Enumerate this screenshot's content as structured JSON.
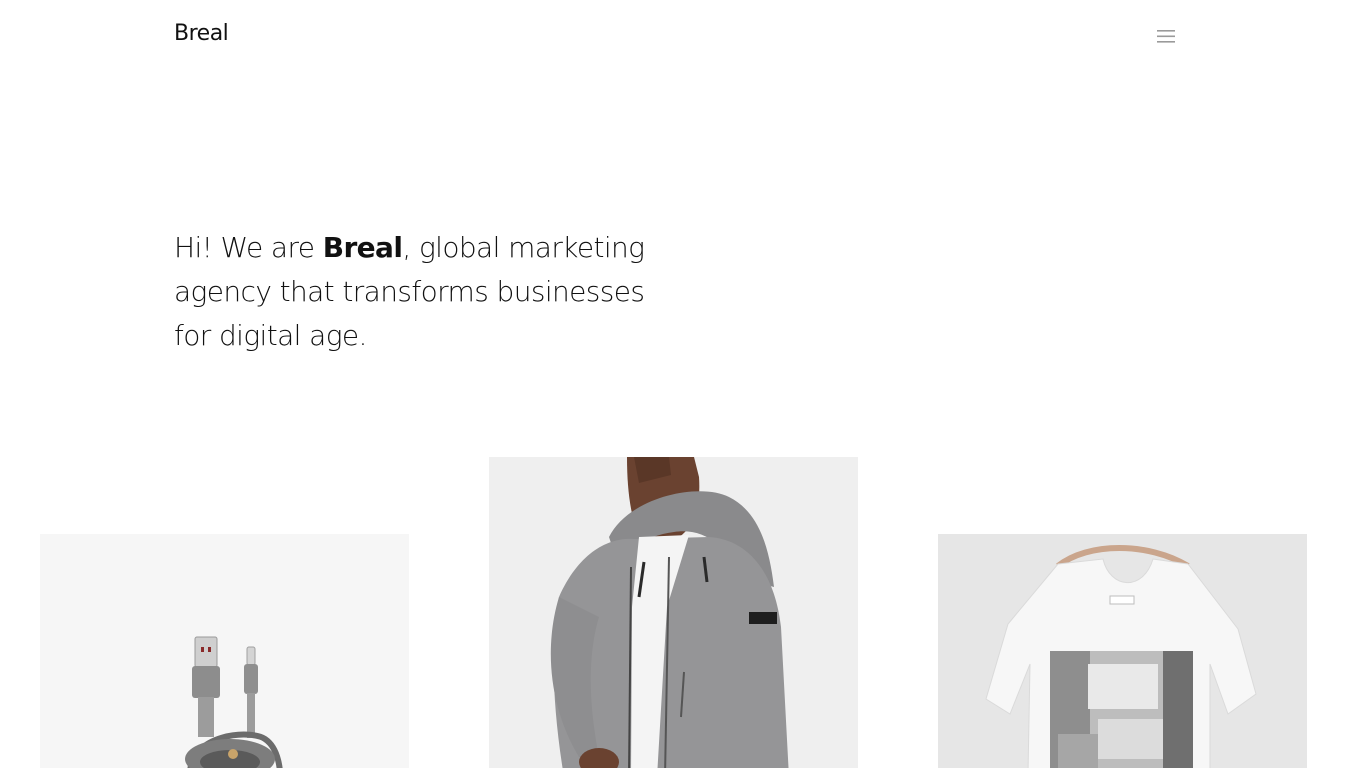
{
  "header": {
    "logo": "Breal",
    "menu_icon": "hamburger-menu-icon"
  },
  "hero": {
    "text_before": "Hi! We are ",
    "brand": "Breal",
    "text_after": ", global marketing agency that transforms businesses for digital age."
  },
  "portfolio": {
    "items": [
      {
        "subject": "usb-lightning-cable",
        "bg": "#f6f6f6"
      },
      {
        "subject": "man-in-grey-hoodie",
        "bg": "#efefef"
      },
      {
        "subject": "white-graphic-tshirt-on-hanger",
        "bg": "#e6e6e6"
      }
    ]
  },
  "colors": {
    "text": "#111111",
    "icon": "#9a9a9a",
    "background": "#ffffff"
  }
}
